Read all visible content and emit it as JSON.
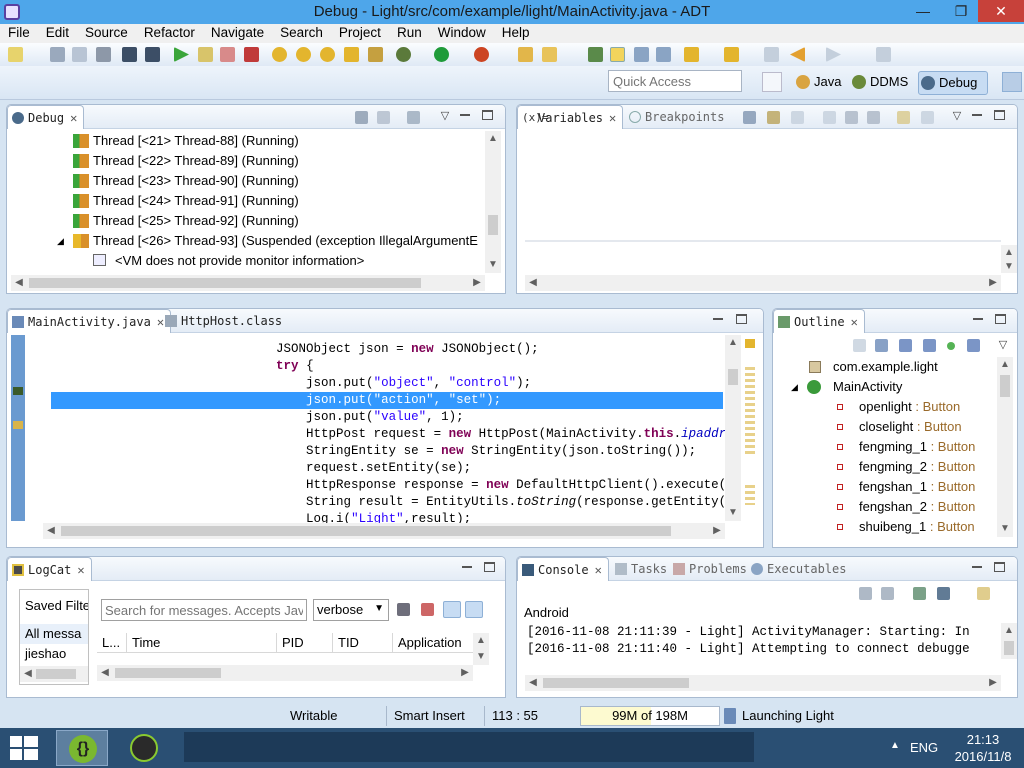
{
  "window": {
    "title": "Debug - Light/src/com/example/light/MainActivity.java - ADT"
  },
  "menu": [
    "File",
    "Edit",
    "Source",
    "Refactor",
    "Navigate",
    "Search",
    "Project",
    "Run",
    "Window",
    "Help"
  ],
  "quick_access": {
    "placeholder": "Quick Access"
  },
  "perspectives": [
    "Java",
    "DDMS",
    "Debug"
  ],
  "debug_view": {
    "tab": "Debug",
    "threads": [
      "Thread [<21> Thread-88] (Running)",
      "Thread [<22> Thread-89] (Running)",
      "Thread [<23> Thread-90] (Running)",
      "Thread [<24> Thread-91] (Running)",
      "Thread [<25> Thread-92] (Running)",
      "Thread [<26> Thread-93] (Suspended (exception IllegalArgumentE"
    ],
    "vm_info": "<VM does not provide monitor information>"
  },
  "variables_view": {
    "tabs": [
      "Variables",
      "Breakpoints"
    ]
  },
  "editor": {
    "tabs": [
      "MainActivity.java",
      "HttpHost.class"
    ],
    "lines": [
      {
        "indent": "                              ",
        "parts": [
          [
            "",
            "JSONObject json = "
          ],
          [
            "kw",
            "new"
          ],
          [
            "",
            " JSONObject();"
          ]
        ]
      },
      {
        "indent": "                              ",
        "parts": [
          [
            "kw",
            "try"
          ],
          [
            "",
            " {"
          ]
        ]
      },
      {
        "indent": "                                  ",
        "parts": [
          [
            "",
            "json.put("
          ],
          [
            "str",
            "\"object\""
          ],
          [
            "",
            ", "
          ],
          [
            "str",
            "\"control\""
          ],
          [
            "",
            ");"
          ]
        ]
      },
      {
        "indent": "                                  ",
        "selected": true,
        "parts": [
          [
            "",
            "json.put("
          ],
          [
            "str",
            "\"action\""
          ],
          [
            "",
            ", "
          ],
          [
            "str",
            "\"set\""
          ],
          [
            "",
            ");"
          ]
        ]
      },
      {
        "indent": "                                  ",
        "parts": [
          [
            "",
            "json.put("
          ],
          [
            "str",
            "\"value\""
          ],
          [
            "",
            ", 1);"
          ]
        ]
      },
      {
        "indent": "                                  ",
        "parts": [
          [
            "",
            "HttpPost request = "
          ],
          [
            "kw",
            "new"
          ],
          [
            "",
            " HttpPost(MainActivity."
          ],
          [
            "kw",
            "this"
          ],
          [
            "",
            "."
          ],
          [
            "fld",
            "ipaddre"
          ]
        ]
      },
      {
        "indent": "                                  ",
        "parts": [
          [
            "",
            "StringEntity se = "
          ],
          [
            "kw",
            "new"
          ],
          [
            "",
            " StringEntity(json.toString());"
          ]
        ]
      },
      {
        "indent": "                                  ",
        "parts": [
          [
            "",
            "request.setEntity(se);"
          ]
        ]
      },
      {
        "indent": "                                  ",
        "parts": [
          [
            "",
            "HttpResponse response = "
          ],
          [
            "kw",
            "new"
          ],
          [
            "",
            " DefaultHttpClient().execute(r"
          ]
        ]
      },
      {
        "indent": "                                  ",
        "parts": [
          [
            "",
            "String result = EntityUtils."
          ],
          [
            "it",
            "toString"
          ],
          [
            "",
            "(response.getEntity()"
          ]
        ]
      },
      {
        "indent": "                                  ",
        "parts": [
          [
            "",
            "Log.i("
          ],
          [
            "str",
            "\"Light\""
          ],
          [
            "",
            ",result);"
          ]
        ]
      }
    ]
  },
  "outline_view": {
    "tab": "Outline",
    "package": "com.example.light",
    "class": "MainActivity",
    "fields": [
      {
        "name": "openlight",
        "type": " : Button"
      },
      {
        "name": "closelight",
        "type": " : Button"
      },
      {
        "name": "fengming_1",
        "type": " : Button"
      },
      {
        "name": "fengming_2",
        "type": " : Button"
      },
      {
        "name": "fengshan_1",
        "type": " : Button"
      },
      {
        "name": "fengshan_2",
        "type": " : Button"
      },
      {
        "name": "shuibeng_1",
        "type": " : Button"
      }
    ]
  },
  "logcat_view": {
    "tab": "LogCat",
    "saved_filters": "Saved Filte",
    "filters": [
      "All messa",
      "jieshao"
    ],
    "search_placeholder": "Search for messages. Accepts Java",
    "level": "verbose",
    "columns": [
      "L...",
      "Time",
      "PID",
      "TID",
      "Application"
    ]
  },
  "console_view": {
    "tabs": [
      "Console",
      "Tasks",
      "Problems",
      "Executables"
    ],
    "name": "Android",
    "lines": [
      "[2016-11-08 21:11:39 - Light] ActivityManager: Starting: In",
      "[2016-11-08 21:11:40 - Light] Attempting to connect debugge"
    ]
  },
  "status": {
    "mode": "Writable",
    "insert": "Smart Insert",
    "position": "113 : 55",
    "heap": "99M of 198M",
    "task": "Launching Light"
  },
  "taskbar": {
    "lang": "ENG",
    "time": "21:13",
    "date": "2016/11/8"
  }
}
